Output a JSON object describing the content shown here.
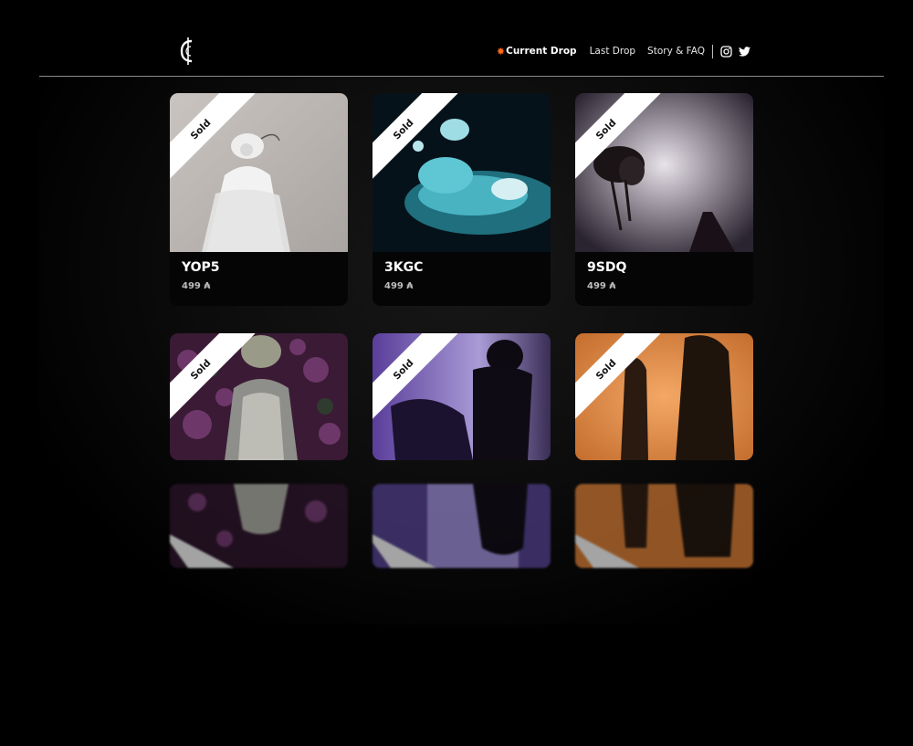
{
  "header": {
    "nav": {
      "current_drop": "Current Drop",
      "last_drop": "Last Drop",
      "story_faq": "Story & FAQ"
    },
    "icons": [
      "logo-icon",
      "spark-icon",
      "instagram-icon",
      "twitter-icon"
    ]
  },
  "cards": [
    {
      "badge": "Sold",
      "title": "YOP5",
      "price": "499 ₳"
    },
    {
      "badge": "Sold",
      "title": "3KGC",
      "price": "499 ₳"
    },
    {
      "badge": "Sold",
      "title": "9SDQ",
      "price": "499 ₳"
    },
    {
      "badge": "Sold"
    },
    {
      "badge": "Sold"
    },
    {
      "badge": "Sold"
    }
  ],
  "colors": {
    "background": "#000000",
    "accent": "#ff6a1a",
    "ribbon": "#ffffff"
  }
}
